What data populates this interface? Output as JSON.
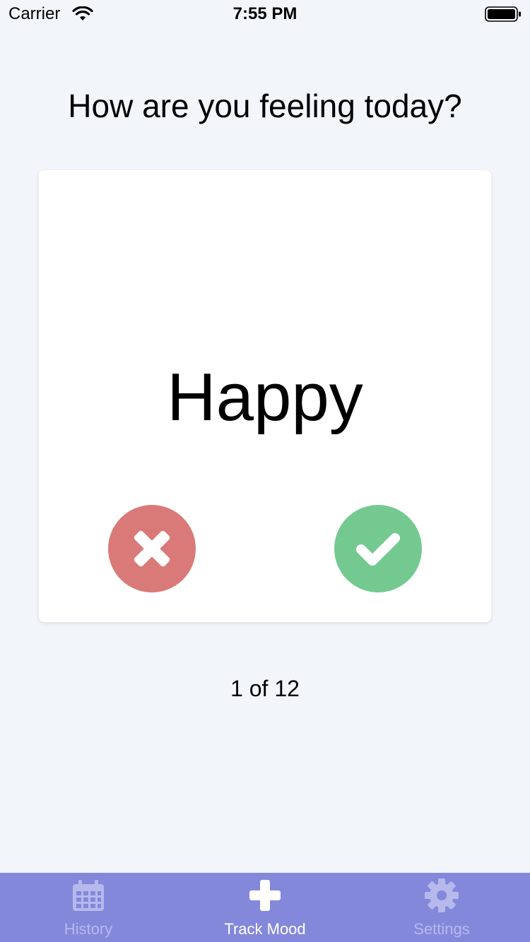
{
  "status_bar": {
    "carrier": "Carrier",
    "time": "7:55 PM",
    "icons": [
      "wifi-icon",
      "battery-icon"
    ]
  },
  "prompt": {
    "question": "How are you feeling today?"
  },
  "card": {
    "mood": "Happy",
    "reject_icon": "close-icon",
    "accept_icon": "checkmark-icon"
  },
  "progress": {
    "label": "1 of 12",
    "current": 1,
    "total": 12
  },
  "tabbar": {
    "tabs": [
      {
        "label": "History",
        "icon": "calendar-icon",
        "active": false
      },
      {
        "label": "Track Mood",
        "icon": "plus-icon",
        "active": true
      },
      {
        "label": "Settings",
        "icon": "gear-icon",
        "active": false
      }
    ]
  },
  "colors": {
    "background": "#f2f5fa",
    "tabbar": "#8488db",
    "tab_inactive": "#b6b9ec",
    "tab_active": "#ffffff",
    "reject": "#d97a78",
    "accept": "#74c990"
  }
}
